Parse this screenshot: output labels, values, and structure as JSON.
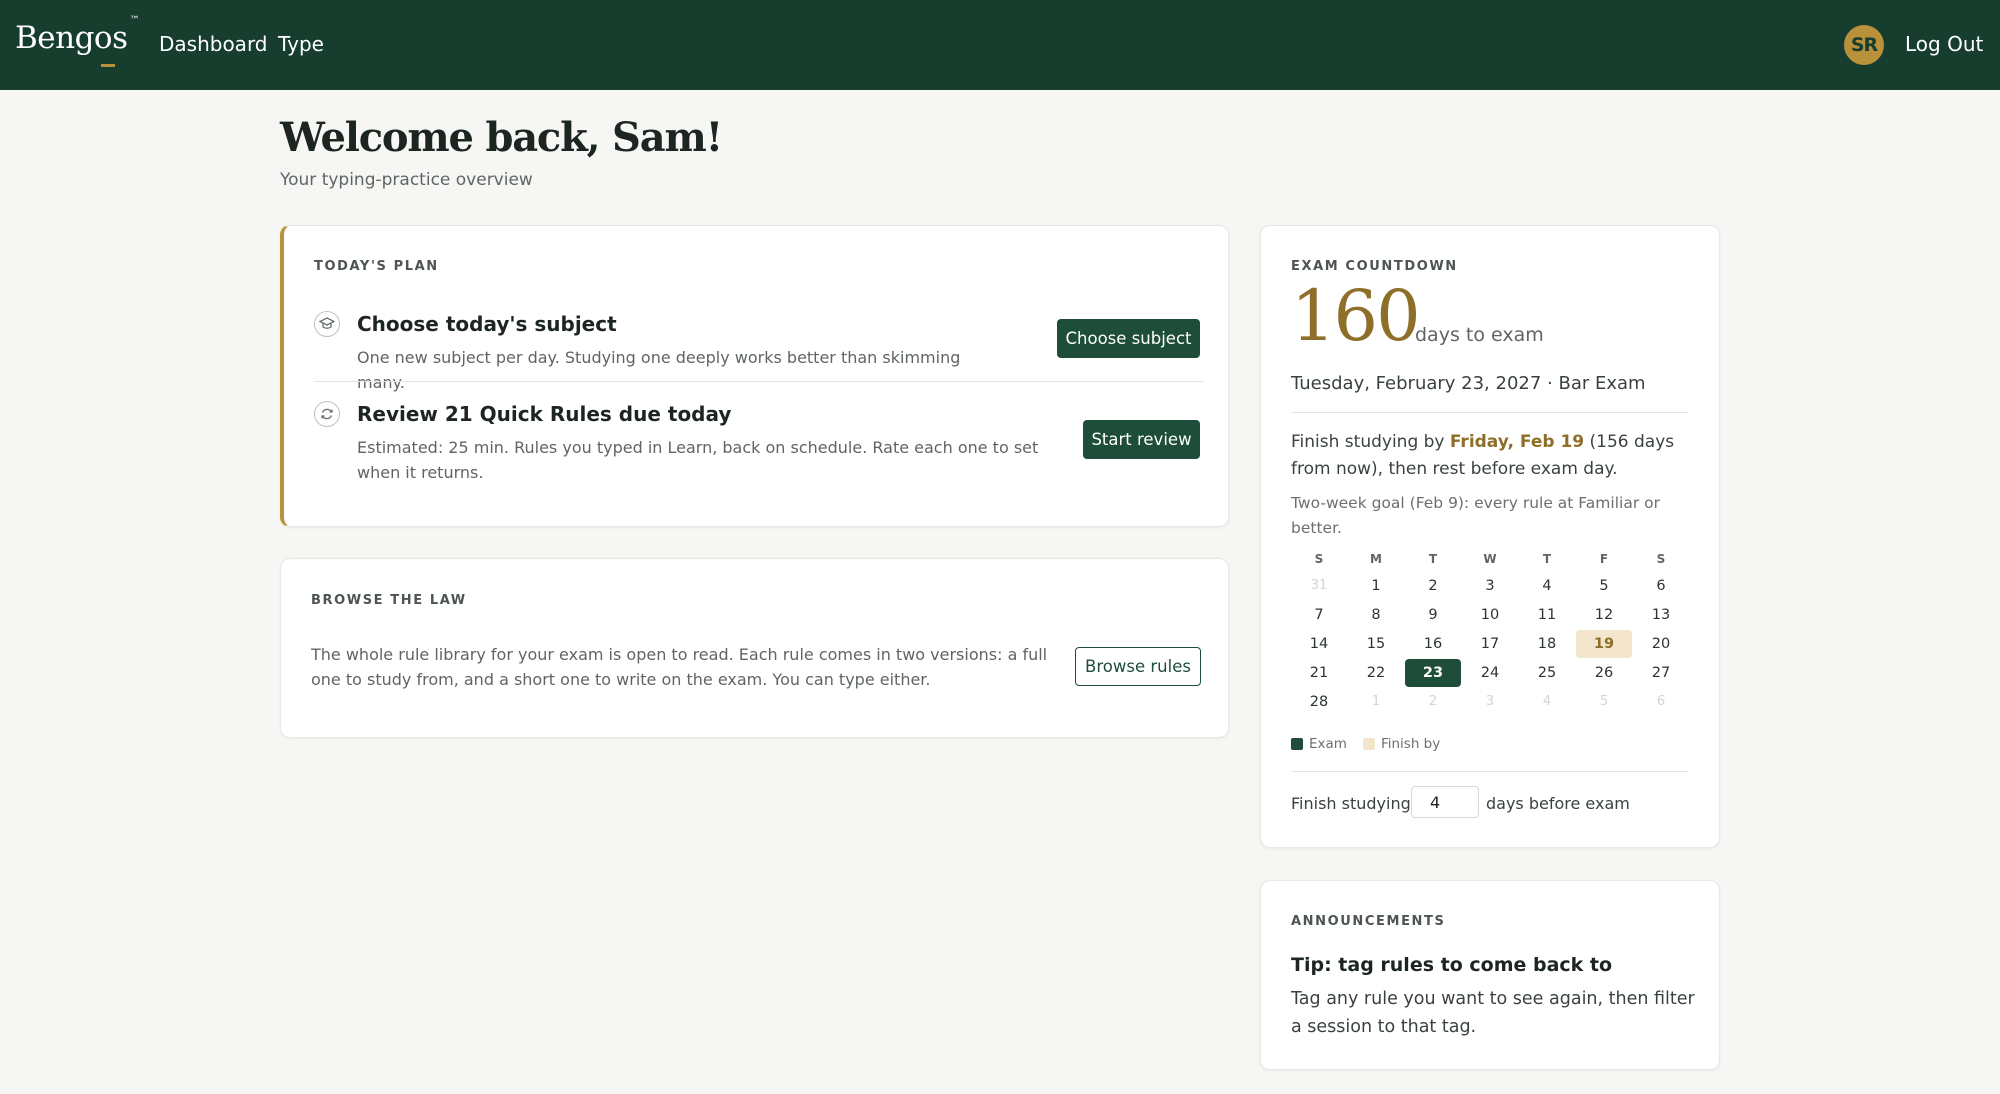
{
  "header": {
    "logo": "Bengos",
    "logo_tm": "™",
    "nav": [
      {
        "label": "Dashboard"
      },
      {
        "label": "Type"
      }
    ],
    "avatar_initials": "SR",
    "logout_label": "Log Out"
  },
  "page": {
    "title": "Welcome back, Sam!",
    "subtitle": "Your typing-practice overview"
  },
  "plan": {
    "eyebrow": "TODAY'S PLAN",
    "tasks": [
      {
        "icon": "graduation-cap-icon",
        "title": "Choose today's subject",
        "desc": "One new subject per day. Studying one deeply works better than skimming many.",
        "button": "Choose subject"
      },
      {
        "icon": "refresh-icon",
        "title": "Review 21 Quick Rules due today",
        "desc": "Estimated: 25 min. Rules you typed in Learn, back on schedule. Rate each one to set when it returns.",
        "button": "Start review"
      }
    ]
  },
  "browse": {
    "eyebrow": "BROWSE THE LAW",
    "text": "The whole rule library for your exam is open to read. Each rule comes in two versions: a full one to study from, and a short one to write on the exam. You can type either.",
    "button": "Browse rules"
  },
  "countdown": {
    "eyebrow": "EXAM COUNTDOWN",
    "days": "160",
    "days_label": "days to exam",
    "exam_date": "Tuesday, February 23, 2027 · Bar Exam",
    "finish_prefix": "Finish studying by ",
    "finish_date": "Friday, Feb 19",
    "finish_suffix": " (156 days from now), then rest before exam day.",
    "goal": "Two-week goal (Feb 9): every rule at Familiar or better.",
    "calendar": {
      "weekdays": [
        "S",
        "M",
        "T",
        "W",
        "T",
        "F",
        "S"
      ],
      "weeks": [
        [
          "31",
          "1",
          "2",
          "3",
          "4",
          "5",
          "6"
        ],
        [
          "7",
          "8",
          "9",
          "10",
          "11",
          "12",
          "13"
        ],
        [
          "14",
          "15",
          "16",
          "17",
          "18",
          "19",
          "20"
        ],
        [
          "21",
          "22",
          "23",
          "24",
          "25",
          "26",
          "27"
        ],
        [
          "28",
          "1",
          "2",
          "3",
          "4",
          "5",
          "6"
        ]
      ],
      "exam_day": "23",
      "finish_day": "19"
    },
    "legend": [
      {
        "label": "Exam",
        "color": "#1e4d3a"
      },
      {
        "label": "Finish by",
        "color": "#f3e6cc"
      }
    ],
    "finish_label": "Finish studying",
    "finish_days_value": "4",
    "finish_suffix_label": "days before exam"
  },
  "announcements": {
    "eyebrow": "ANNOUNCEMENTS",
    "title": "Tip: tag rules to come back to",
    "body": "Tag any rule you want to see again, then filter a session to that tag."
  },
  "colors": {
    "header_bg": "#173d2e",
    "accent_gold": "#b8913a",
    "primary_button": "#1e4d3a"
  }
}
